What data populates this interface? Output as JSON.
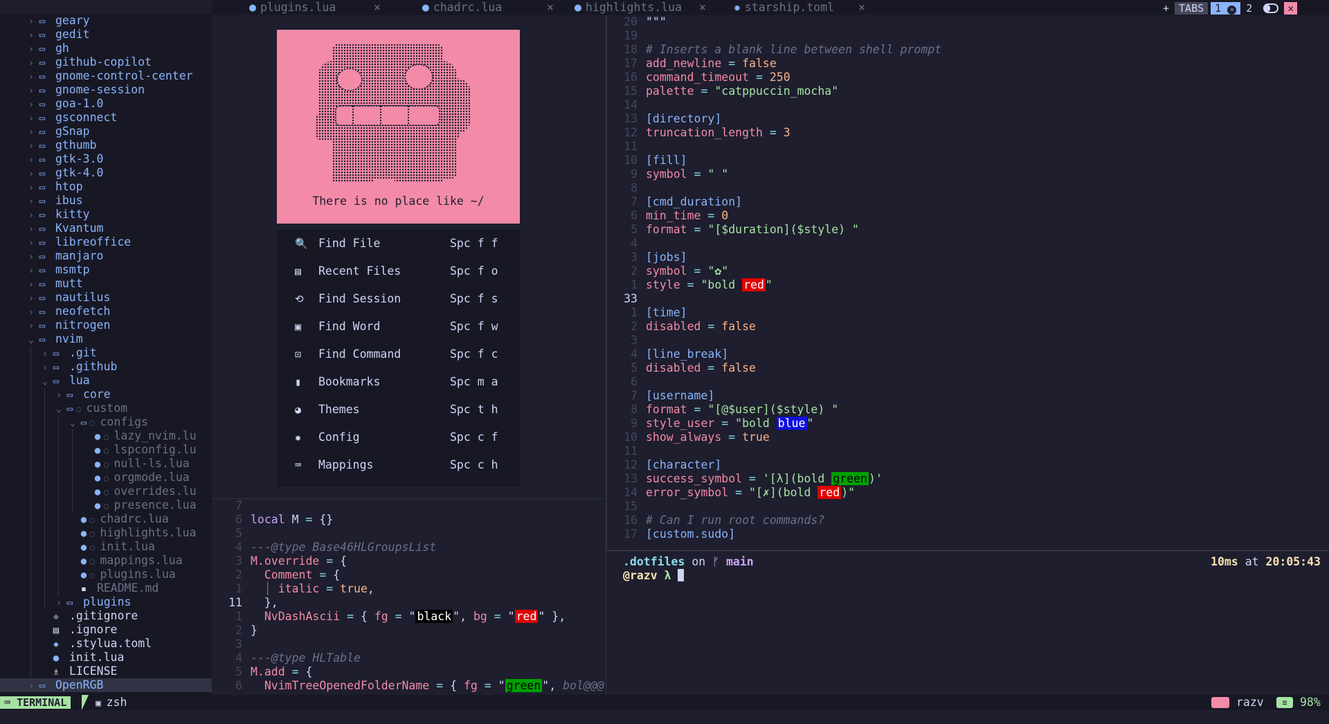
{
  "tree": [
    {
      "indent": 0,
      "chev": "›",
      "icon": "folder",
      "label": "geary"
    },
    {
      "indent": 0,
      "chev": "›",
      "icon": "folder",
      "label": "gedit"
    },
    {
      "indent": 0,
      "chev": "›",
      "icon": "folder",
      "label": "gh"
    },
    {
      "indent": 0,
      "chev": "›",
      "icon": "folder",
      "label": "github-copilot"
    },
    {
      "indent": 0,
      "chev": "›",
      "icon": "folder",
      "label": "gnome-control-center"
    },
    {
      "indent": 0,
      "chev": "›",
      "icon": "folder",
      "label": "gnome-session"
    },
    {
      "indent": 0,
      "chev": "›",
      "icon": "folder",
      "label": "goa-1.0"
    },
    {
      "indent": 0,
      "chev": "›",
      "icon": "folder",
      "label": "gsconnect"
    },
    {
      "indent": 0,
      "chev": "›",
      "icon": "folder",
      "label": "gSnap"
    },
    {
      "indent": 0,
      "chev": "›",
      "icon": "folder",
      "label": "gthumb"
    },
    {
      "indent": 0,
      "chev": "›",
      "icon": "folder",
      "label": "gtk-3.0"
    },
    {
      "indent": 0,
      "chev": "›",
      "icon": "folder",
      "label": "gtk-4.0"
    },
    {
      "indent": 0,
      "chev": "›",
      "icon": "folder",
      "label": "htop"
    },
    {
      "indent": 0,
      "chev": "›",
      "icon": "folder",
      "label": "ibus"
    },
    {
      "indent": 0,
      "chev": "›",
      "icon": "folder",
      "label": "kitty"
    },
    {
      "indent": 0,
      "chev": "›",
      "icon": "folder",
      "label": "Kvantum"
    },
    {
      "indent": 0,
      "chev": "›",
      "icon": "folder",
      "label": "libreoffice"
    },
    {
      "indent": 0,
      "chev": "›",
      "icon": "folder",
      "label": "manjaro"
    },
    {
      "indent": 0,
      "chev": "›",
      "icon": "folder",
      "label": "msmtp"
    },
    {
      "indent": 0,
      "chev": "›",
      "icon": "folder",
      "label": "mutt"
    },
    {
      "indent": 0,
      "chev": "›",
      "icon": "folder",
      "label": "nautilus"
    },
    {
      "indent": 0,
      "chev": "›",
      "icon": "folder",
      "label": "neofetch"
    },
    {
      "indent": 0,
      "chev": "›",
      "icon": "folder",
      "label": "nitrogen"
    },
    {
      "indent": 0,
      "chev": "⌄",
      "icon": "folder-open",
      "label": "nvim"
    },
    {
      "indent": 1,
      "chev": "›",
      "icon": "folder",
      "label": ".git"
    },
    {
      "indent": 1,
      "chev": "›",
      "icon": "folder",
      "label": ".github"
    },
    {
      "indent": 1,
      "chev": "⌄",
      "icon": "folder-open",
      "label": "lua"
    },
    {
      "indent": 2,
      "chev": "›",
      "icon": "folder",
      "label": "core"
    },
    {
      "indent": 2,
      "chev": "⌄",
      "icon": "folder-open",
      "label": "custom",
      "dim": true,
      "mark": true
    },
    {
      "indent": 3,
      "chev": "⌄",
      "icon": "folder-open",
      "label": "configs",
      "dim": true,
      "mark": true
    },
    {
      "indent": 4,
      "chev": "",
      "icon": "lua",
      "label": "lazy_nvim.lu",
      "dim": true,
      "mark": true
    },
    {
      "indent": 4,
      "chev": "",
      "icon": "lua",
      "label": "lspconfig.lu",
      "dim": true,
      "mark": true
    },
    {
      "indent": 4,
      "chev": "",
      "icon": "lua",
      "label": "null-ls.lua",
      "dim": true,
      "mark": true
    },
    {
      "indent": 4,
      "chev": "",
      "icon": "lua",
      "label": "orgmode.lua",
      "dim": true,
      "mark": true
    },
    {
      "indent": 4,
      "chev": "",
      "icon": "lua",
      "label": "overrides.lu",
      "dim": true,
      "mark": true
    },
    {
      "indent": 4,
      "chev": "",
      "icon": "lua",
      "label": "presence.lua",
      "dim": true,
      "mark": true
    },
    {
      "indent": 3,
      "chev": "",
      "icon": "lua",
      "label": "chadrc.lua",
      "dim": true,
      "mark": true
    },
    {
      "indent": 3,
      "chev": "",
      "icon": "lua",
      "label": "highlights.lua",
      "dim": true,
      "mark": true
    },
    {
      "indent": 3,
      "chev": "",
      "icon": "lua",
      "label": "init.lua",
      "dim": true,
      "mark": true
    },
    {
      "indent": 3,
      "chev": "",
      "icon": "lua",
      "label": "mappings.lua",
      "dim": true,
      "mark": true
    },
    {
      "indent": 3,
      "chev": "",
      "icon": "lua",
      "label": "plugins.lua",
      "dim": true,
      "mark": true
    },
    {
      "indent": 3,
      "chev": "",
      "icon": "md",
      "label": "README.md",
      "dim": true
    },
    {
      "indent": 2,
      "chev": "›",
      "icon": "folder",
      "label": "plugins"
    },
    {
      "indent": 1,
      "chev": "",
      "icon": "git",
      "label": ".gitignore",
      "file": true
    },
    {
      "indent": 1,
      "chev": "",
      "icon": "doc",
      "label": ".ignore",
      "file": true
    },
    {
      "indent": 1,
      "chev": "",
      "icon": "gear",
      "label": ".stylua.toml",
      "file": true
    },
    {
      "indent": 1,
      "chev": "",
      "icon": "lua",
      "label": "init.lua",
      "file": true
    },
    {
      "indent": 1,
      "chev": "",
      "icon": "license",
      "label": "LICENSE",
      "file": true
    },
    {
      "indent": 0,
      "chev": "›",
      "icon": "folder",
      "label": "OpenRGB",
      "sel": true
    }
  ],
  "tabs": [
    {
      "label": "plugins.lua",
      "icon": "lua"
    },
    {
      "label": "chadrc.lua",
      "icon": "lua"
    },
    {
      "label": "highlights.lua",
      "icon": "lua"
    },
    {
      "label": "starship.toml",
      "icon": "gear"
    }
  ],
  "tabbar_right": {
    "plus": "+",
    "tabs_label": "TABS",
    "tab1": "1",
    "tab2": "2"
  },
  "dashboard": {
    "tagline": "There is no place like ~/",
    "items": [
      {
        "icon": "search-icon",
        "glyph": "🔍",
        "label": "Find File",
        "key": "Spc f f"
      },
      {
        "icon": "file-icon",
        "glyph": "▤",
        "label": "Recent Files",
        "key": "Spc f o"
      },
      {
        "icon": "history-icon",
        "glyph": "⟲",
        "label": "Find Session",
        "key": "Spc f s"
      },
      {
        "icon": "word-icon",
        "glyph": "▣",
        "label": "Find Word",
        "key": "Spc f w"
      },
      {
        "icon": "terminal-icon",
        "glyph": "⊡",
        "label": "Find Command",
        "key": "Spc f c"
      },
      {
        "icon": "bookmark-icon",
        "glyph": "▮",
        "label": "Bookmarks",
        "key": "Spc m a"
      },
      {
        "icon": "palette-icon",
        "glyph": "◕",
        "label": "Themes",
        "key": "Spc t h"
      },
      {
        "icon": "gear-icon",
        "glyph": "✹",
        "label": "Config",
        "key": "Spc c f"
      },
      {
        "icon": "keyboard-icon",
        "glyph": "⌨",
        "label": "Mappings",
        "key": "Spc c h"
      }
    ]
  },
  "leftcode": [
    {
      "ln": "7",
      "html": ""
    },
    {
      "ln": "6",
      "html": "<span class='kw'>local</span> M <span class='op'>=</span> {}"
    },
    {
      "ln": "5",
      "html": ""
    },
    {
      "ln": "4",
      "html": "<span class='cmt'>---@type Base46HLGroupsList</span>"
    },
    {
      "ln": "3",
      "html": "<span class='key'>M.override</span> <span class='op'>=</span> {"
    },
    {
      "ln": "2",
      "html": "  <span class='key'>Comment</span> <span class='op'>=</span> {"
    },
    {
      "ln": "1",
      "html": "  <span class='cmt'>│</span> <span class='key'>italic</span> <span class='op'>=</span> <span class='num'>true</span>,"
    },
    {
      "ln": "11",
      "cur": true,
      "html": "  },"
    },
    {
      "ln": "1",
      "html": "  <span class='key'>NvDashAscii</span> <span class='op'>=</span> { <span class='key'>fg</span> <span class='op'>=</span> \"<span class='hblack'>black</span>\", <span class='key'>bg</span> <span class='op'>=</span> \"<span class='hred'>red</span>\" },"
    },
    {
      "ln": "2",
      "html": "}"
    },
    {
      "ln": "3",
      "html": ""
    },
    {
      "ln": "4",
      "html": "<span class='cmt'>---@type HLTable</span>"
    },
    {
      "ln": "5",
      "html": "<span class='key'>M.add</span> <span class='op'>=</span> {"
    },
    {
      "ln": "6",
      "html": "  <span class='key'>NvimTreeOpenedFolderName</span> <span class='op'>=</span> { <span class='key'>fg</span> <span class='op'>=</span> \"<span class='hgreen'>green</span>\", <span class='cmt'>bol@@@</span>"
    }
  ],
  "rightcode": [
    {
      "ln": "20",
      "html": "\"\"\""
    },
    {
      "ln": "19",
      "html": ""
    },
    {
      "ln": "18",
      "html": "<span class='cmt'># Inserts a blank line between shell prompt</span>"
    },
    {
      "ln": "17",
      "html": "<span class='key'>add_newline</span> <span class='op'>=</span> <span class='num'>false</span>"
    },
    {
      "ln": "16",
      "html": "<span class='key'>command_timeout</span> <span class='op'>=</span> <span class='num'>250</span>"
    },
    {
      "ln": "15",
      "html": "<span class='key'>palette</span> <span class='op'>=</span> <span class='str'>\"catppuccin_mocha\"</span>"
    },
    {
      "ln": "14",
      "html": ""
    },
    {
      "ln": "13",
      "html": "<span class='sec'>[directory]</span>"
    },
    {
      "ln": "12",
      "html": "<span class='key'>truncation_length</span> <span class='op'>=</span> <span class='num'>3</span>"
    },
    {
      "ln": "11",
      "html": ""
    },
    {
      "ln": "10",
      "html": "<span class='sec'>[fill]</span>"
    },
    {
      "ln": "9",
      "html": "<span class='key'>symbol</span> <span class='op'>=</span> <span class='str'>\" \"</span>"
    },
    {
      "ln": "8",
      "html": ""
    },
    {
      "ln": "7",
      "html": "<span class='sec'>[cmd_duration]</span>"
    },
    {
      "ln": "6",
      "html": "<span class='key'>min_time</span> <span class='op'>=</span> <span class='num'>0</span>"
    },
    {
      "ln": "5",
      "html": "<span class='key'>format</span> <span class='op'>=</span> <span class='str'>\"[$duration]($style) \"</span>"
    },
    {
      "ln": "4",
      "html": ""
    },
    {
      "ln": "3",
      "html": "<span class='sec'>[jobs]</span>"
    },
    {
      "ln": "2",
      "html": "<span class='key'>symbol</span> <span class='op'>=</span> <span class='str'>\"✿\"</span>"
    },
    {
      "ln": "1",
      "html": "<span class='key'>style</span> <span class='op'>=</span> <span class='str'>\"bold </span><span class='hred'>red</span><span class='str'>\"</span>"
    },
    {
      "ln": "33",
      "cur": true,
      "html": ""
    },
    {
      "ln": "1",
      "html": "<span class='sec'>[time]</span>"
    },
    {
      "ln": "2",
      "html": "<span class='key'>disabled</span> <span class='op'>=</span> <span class='num'>false</span>"
    },
    {
      "ln": "3",
      "html": ""
    },
    {
      "ln": "4",
      "html": "<span class='sec'>[line_break]</span>"
    },
    {
      "ln": "5",
      "html": "<span class='key'>disabled</span> <span class='op'>=</span> <span class='num'>false</span>"
    },
    {
      "ln": "6",
      "html": ""
    },
    {
      "ln": "7",
      "html": "<span class='sec'>[username]</span>"
    },
    {
      "ln": "8",
      "html": "<span class='key'>format</span> <span class='op'>=</span> <span class='str'>\"[@$user]($style) \"</span>"
    },
    {
      "ln": "9",
      "html": "<span class='key'>style_user</span> <span class='op'>=</span> <span class='str'>\"bold </span><span class='hblue'>blue</span><span class='str'>\"</span>"
    },
    {
      "ln": "10",
      "html": "<span class='key'>show_always</span> <span class='op'>=</span> <span class='num'>true</span>"
    },
    {
      "ln": "11",
      "html": ""
    },
    {
      "ln": "12",
      "html": "<span class='sec'>[character]</span>"
    },
    {
      "ln": "13",
      "html": "<span class='key'>success_symbol</span> <span class='op'>=</span> <span class='str'>'[λ](bold </span><span class='hgreen'>green</span><span class='str'>)'</span>"
    },
    {
      "ln": "14",
      "html": "<span class='key'>error_symbol</span> <span class='op'>=</span> <span class='str'>\"[✗](bold </span><span class='hred'>red</span><span class='str'>)\"</span>"
    },
    {
      "ln": "15",
      "html": ""
    },
    {
      "ln": "16",
      "html": "<span class='cmt'># Can I run root commands?</span>"
    },
    {
      "ln": "17",
      "html": "<span class='sec'>[custom.sudo]</span>"
    }
  ],
  "terminal": {
    "dir": ".dotfiles",
    "on": " on ",
    "branch_icon": "",
    "branch": " main",
    "duration": "10ms",
    "at": " at ",
    "time": "20:05:43",
    "user": "@razv",
    "prompt": " λ "
  },
  "status": {
    "mode": "TERMINAL",
    "shell": "zsh",
    "host": "razv",
    "percent": "98%"
  }
}
